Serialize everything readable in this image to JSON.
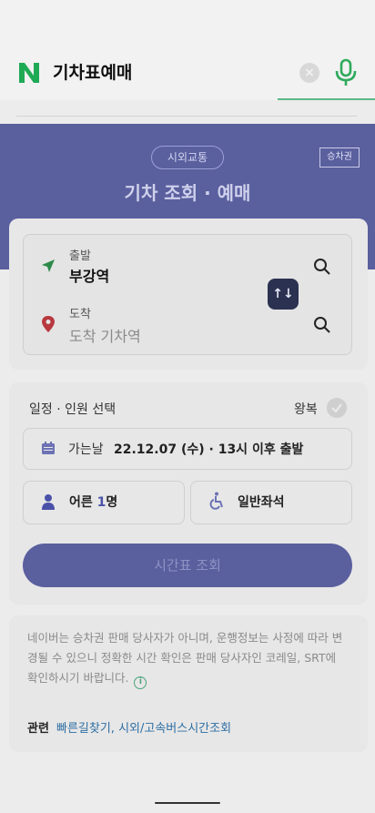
{
  "search": {
    "query": "기차표예매",
    "clear_icon": "×"
  },
  "hero": {
    "chip": "시외교통",
    "ticket_button": "승차권",
    "title": "기차 조회 · 예매"
  },
  "route": {
    "departure_label": "출발",
    "departure_value": "부강역",
    "arrival_label": "도착",
    "arrival_placeholder": "도착 기차역",
    "swap_icon": "↑↓"
  },
  "schedule": {
    "title": "일정 · 인원 선택",
    "round_trip_label": "왕복",
    "date_label": "가는날",
    "date_value": "22.12.07 (수) · 13시 이후 출발",
    "passenger_prefix": "어른 ",
    "passenger_count": "1",
    "passenger_suffix": "명",
    "seat_class": "일반좌석",
    "submit_label": "시간표 조회"
  },
  "notice": {
    "text": "네이버는 승차권 판매 당사자가 아니며, 운행정보는 사정에 따라 변경될 수 있으니 정확한 시간 확인은 판매 당사자인 코레일, SRT에 확인하시기 바랍니다.",
    "info_icon": "i",
    "related_label": "관련",
    "related_links": "빠른길찾기, 시외/고속버스시간조회"
  },
  "colors": {
    "brand_green": "#19a05a",
    "accent": "#5a5f9e",
    "link": "#2d6ea3"
  }
}
